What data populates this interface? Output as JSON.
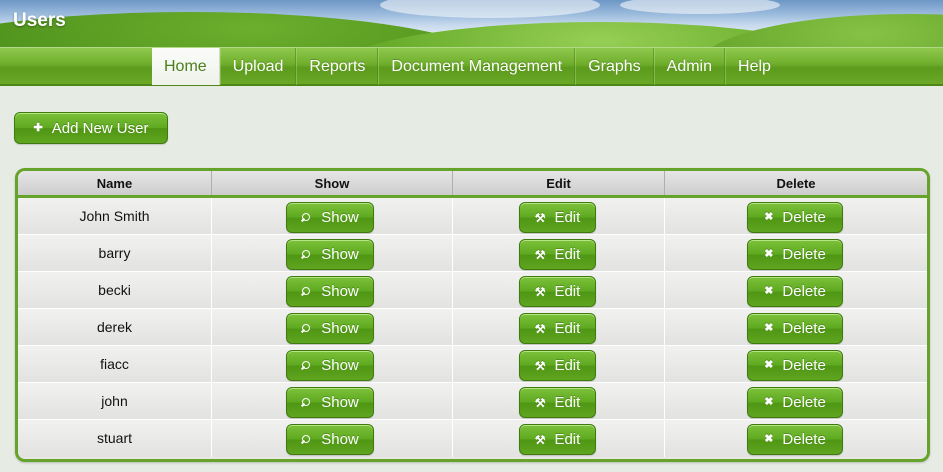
{
  "header": {
    "title": "Users"
  },
  "nav": {
    "items": [
      "Home",
      "Upload",
      "Reports",
      "Document Management",
      "Graphs",
      "Admin",
      "Help"
    ],
    "active": "Home"
  },
  "actions": {
    "add_user_label": "Add New User",
    "add_icon": "plus-icon"
  },
  "table": {
    "columns": [
      "Name",
      "Show",
      "Edit",
      "Delete"
    ],
    "rows": [
      {
        "name": "John Smith"
      },
      {
        "name": "barry"
      },
      {
        "name": "becki"
      },
      {
        "name": "derek"
      },
      {
        "name": "fiacc"
      },
      {
        "name": "john"
      },
      {
        "name": "stuart"
      }
    ],
    "show_label": "Show",
    "edit_label": "Edit",
    "delete_label": "Delete",
    "show_icon": "magnifier-icon",
    "edit_icon": "wrench-icon",
    "delete_icon": "x-icon"
  },
  "colors": {
    "accent": "#5ea91f",
    "border": "#66a32b",
    "nav_text": "#ffffff"
  }
}
